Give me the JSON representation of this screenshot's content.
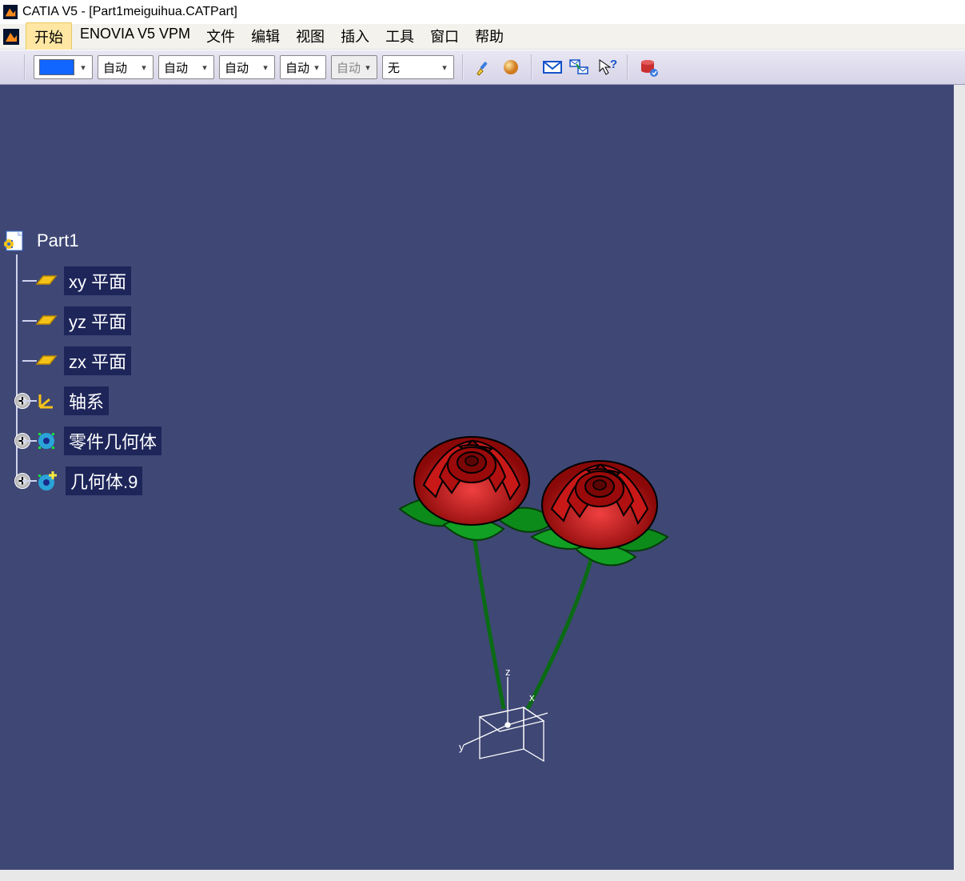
{
  "title": "CATIA V5 - [Part1meiguihua.CATPart]",
  "menu": {
    "items": [
      "开始",
      "ENOVIA V5 VPM",
      "文件",
      "编辑",
      "视图",
      "插入",
      "工具",
      "窗口",
      "帮助"
    ],
    "activeIndex": 0
  },
  "toolbar": {
    "colorSwatch": "#1066ff",
    "combos": [
      {
        "value": "",
        "kind": "color"
      },
      {
        "value": "自动"
      },
      {
        "value": "自动"
      },
      {
        "value": "自动"
      },
      {
        "value": "自动",
        "narrow": true
      },
      {
        "value": "自动",
        "narrow": true,
        "disabled": true
      },
      {
        "value": "无",
        "wide": true
      }
    ]
  },
  "tree": {
    "root": "Part1",
    "children": [
      {
        "label": "xy 平面",
        "icon": "plane"
      },
      {
        "label": "yz 平面",
        "icon": "plane"
      },
      {
        "label": "zx 平面",
        "icon": "plane"
      },
      {
        "label": "轴系",
        "icon": "axis",
        "expandable": true
      },
      {
        "label": "零件几何体",
        "icon": "body",
        "expandable": true
      },
      {
        "label": "几何体.9",
        "icon": "body-new",
        "expandable": true
      }
    ]
  },
  "compass": {
    "x": "x",
    "y": "y",
    "z": "z"
  }
}
